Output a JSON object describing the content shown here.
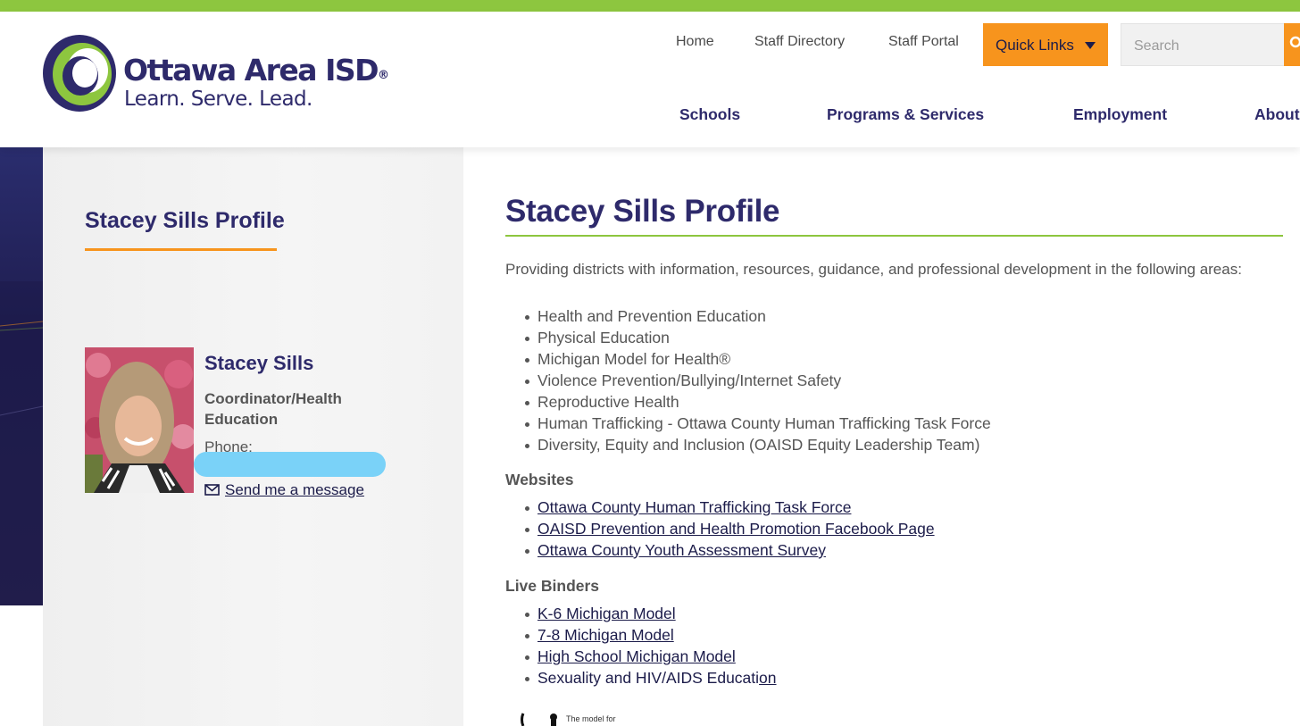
{
  "brand": {
    "name": "Ottawa Area ISD",
    "registered": "®",
    "tagline": "Learn. Serve. Lead."
  },
  "utility_nav": [
    "Home",
    "Staff Directory",
    "Staff Portal"
  ],
  "quick_links": {
    "label": "Quick Links"
  },
  "search": {
    "placeholder": "Search"
  },
  "main_nav": [
    "Schools",
    "Programs & Services",
    "Employment",
    "About"
  ],
  "sidebar": {
    "title": "Stacey Sills Profile",
    "profile": {
      "name": "Stacey Sills",
      "job_title": "Coordinator/Health Education",
      "phone_label": "Phone:",
      "message_link": "Send me a message"
    }
  },
  "main": {
    "title": "Stacey Sills Profile",
    "intro": "Providing districts with information, resources, guidance, and professional development in the following areas:",
    "areas": [
      "Health and Prevention Education",
      "Physical Education",
      "Michigan Model for Health®",
      "Violence Prevention/Bullying/Internet Safety",
      "Reproductive Health",
      "Human Trafficking - Ottawa County Human Trafficking Task Force",
      "Diversity, Equity and Inclusion (OAISD Equity Leadership Team)"
    ],
    "websites_heading": "Websites",
    "websites": [
      "Ottawa County Human Trafficking Task Force",
      "OAISD Prevention and Health Promotion Facebook Page",
      "Ottawa County Youth Assessment Survey"
    ],
    "binders_heading": "Live Binders",
    "binders": [
      "K-6 Michigan Model",
      "7-8 Michigan Model",
      "High School Michigan Model"
    ],
    "binder_last_prefix": "Sexuality and HIV/AIDS Educati",
    "binder_last_link": "on",
    "bottom_logo_text": "The model for"
  },
  "colors": {
    "brand_navy": "#2e2a6b",
    "brand_green": "#8dc63f",
    "accent_orange": "#f7941d",
    "redaction_blue": "#7ad2f8"
  },
  "icons": [
    "search-icon",
    "mail-icon",
    "caret-down-icon",
    "logo-swirl-icon"
  ]
}
